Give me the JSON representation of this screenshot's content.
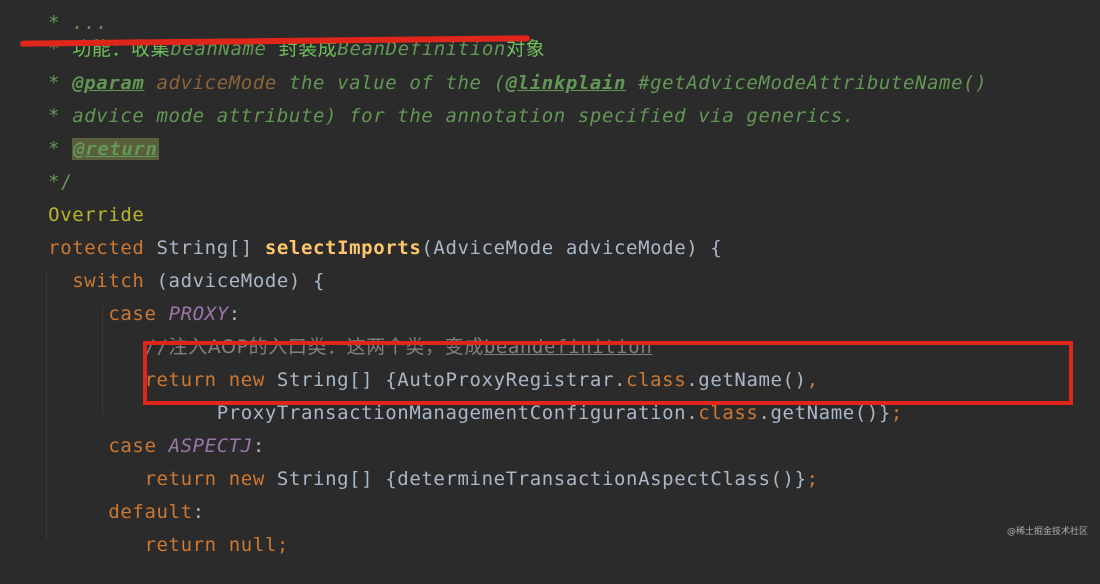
{
  "editor": {
    "theme": "darcula",
    "colors": {
      "background": "#2b2b2b",
      "keyword": "#cc7832",
      "method": "#ffc66d",
      "annotation": "#bbb529",
      "doc_comment": "#629755",
      "line_comment": "#808080",
      "constant": "#9876aa",
      "text": "#a9b7c6",
      "highlight_annotation": "#e0251b"
    },
    "lines": {
      "l0_partial": "* ...",
      "l1": {
        "star": "* ",
        "cn1": "功能：收集",
        "en1": "beanName ",
        "cn2": "封装成",
        "en2": "BeanDefinition",
        "cn3": "对象"
      },
      "l2": {
        "star": "* ",
        "tag": "@param",
        "param": " adviceMode",
        "text1": " the value of the (",
        "link": "@linkplain",
        "text2": " #getAdviceModeAttributeName()"
      },
      "l3": {
        "star": "* ",
        "text": "advice mode attribute) for the annotation specified via generics."
      },
      "l4": {
        "star": "* ",
        "tag": "@return"
      },
      "l5": {
        "text": "*/"
      },
      "l6": {
        "annotation": "Override"
      },
      "l7": {
        "kw": "rotected",
        "t1": " String[] ",
        "method": "selectImports",
        "t2": "(AdviceMode adviceMode) {"
      },
      "l8": {
        "indent": "  ",
        "kw": "switch",
        "t1": " (adviceMode) {"
      },
      "l9": {
        "indent": "     ",
        "kw": "case",
        "sp": " ",
        "const": "PROXY",
        "t1": ":"
      },
      "l10": {
        "indent": "        ",
        "slash": "//",
        "cn": "注入AOP的入口类：这两个类，变成",
        "en": "beandefinition"
      },
      "l11": {
        "indent": "        ",
        "kw1": "return",
        "sp1": " ",
        "kw2": "new",
        "t1": " String[] {AutoProxyRegistrar.",
        "kw3": "class",
        "t2": ".getName()",
        "kw4": ","
      },
      "l12": {
        "indent": "              ",
        "t1": "ProxyTransactionManagementConfiguration.",
        "kw1": "class",
        "t2": ".getName()}",
        "kw2": ";"
      },
      "l13": {
        "indent": "     ",
        "kw": "case",
        "sp": " ",
        "const": "ASPECTJ",
        "t1": ":"
      },
      "l14": {
        "indent": "        ",
        "kw1": "return",
        "sp1": " ",
        "kw2": "new",
        "t1": " String[] {determineTransactionAspectClass()}",
        "kw3": ";"
      },
      "l15": {
        "indent": "     ",
        "kw": "default",
        "t1": ":"
      },
      "l16": {
        "indent": "        ",
        "kw": "return",
        "sp": " ",
        "kw2": "null",
        "kw3": ";"
      }
    }
  },
  "watermark": "@稀土掘金技术社区"
}
